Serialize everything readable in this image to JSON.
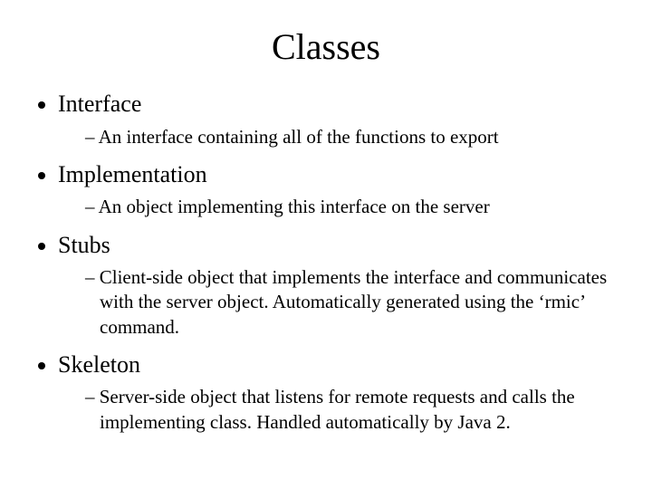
{
  "title": "Classes",
  "items": [
    {
      "heading": "Interface",
      "sub": [
        "An interface containing all of the functions to export"
      ]
    },
    {
      "heading": "Implementation",
      "sub": [
        "An object implementing this interface on the server"
      ]
    },
    {
      "heading": "Stubs",
      "sub": [
        "Client-side object that implements the interface and communicates with the server object.  Automatically generated using the ‘rmic’ command."
      ]
    },
    {
      "heading": "Skeleton",
      "sub": [
        "Server-side object that listens for remote requests and calls the implementing class.  Handled automatically by Java 2."
      ]
    }
  ]
}
